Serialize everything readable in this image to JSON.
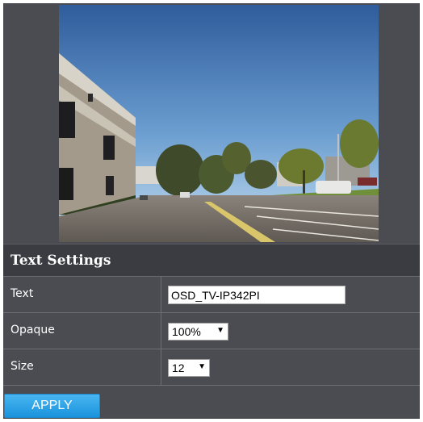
{
  "section": {
    "title": "Text Settings"
  },
  "fields": {
    "text": {
      "label": "Text",
      "value": "OSD_TV-IP342PI"
    },
    "opaque": {
      "label": "Opaque",
      "selected": "100%"
    },
    "size": {
      "label": "Size",
      "selected": "12"
    }
  },
  "actions": {
    "apply_label": "APPLY"
  },
  "icons": {
    "dropdown_arrow": "▼"
  },
  "colors": {
    "panel_bg": "#4b4c52",
    "header_bg": "#3b3c42",
    "apply_button": "#2aa3e8"
  }
}
